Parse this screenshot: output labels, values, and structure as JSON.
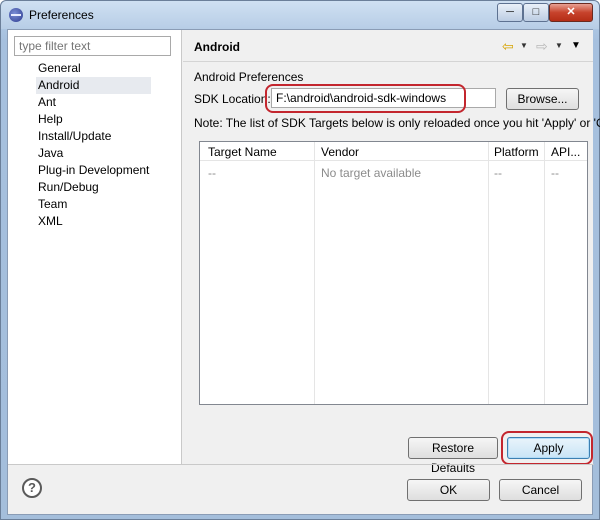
{
  "window": {
    "title": "Preferences"
  },
  "titlebar_controls": {
    "minimize": "─",
    "maximize": "□",
    "close": "✕"
  },
  "sidebar": {
    "filter_placeholder": "type filter text",
    "items": [
      {
        "label": "General"
      },
      {
        "label": "Android",
        "selected": true
      },
      {
        "label": "Ant"
      },
      {
        "label": "Help"
      },
      {
        "label": "Install/Update"
      },
      {
        "label": "Java"
      },
      {
        "label": "Plug-in Development"
      },
      {
        "label": "Run/Debug"
      },
      {
        "label": "Team"
      },
      {
        "label": "XML"
      }
    ]
  },
  "page": {
    "title": "Android",
    "section_label": "Android Preferences",
    "sdk_location_label": "SDK Location:",
    "sdk_location_value": "F:\\android\\android-sdk-windows",
    "browse_label": "Browse...",
    "note": "Note: The list of SDK Targets below is only reloaded once you hit 'Apply' or 'OK'."
  },
  "nav": {
    "back_icon": "back-arrow-icon",
    "forward_icon": "forward-arrow-icon",
    "menu_icon": "view-menu-icon"
  },
  "targets_table": {
    "columns": [
      "Target Name",
      "Vendor",
      "Platform",
      "API..."
    ],
    "rows": [
      [
        "--",
        "No target available",
        "--",
        "--"
      ]
    ]
  },
  "buttons": {
    "restore_defaults": "Restore Defaults",
    "apply": "Apply",
    "ok": "OK",
    "cancel": "Cancel"
  },
  "colors": {
    "highlight": "#c3262e",
    "selection": "#e7eaef"
  }
}
